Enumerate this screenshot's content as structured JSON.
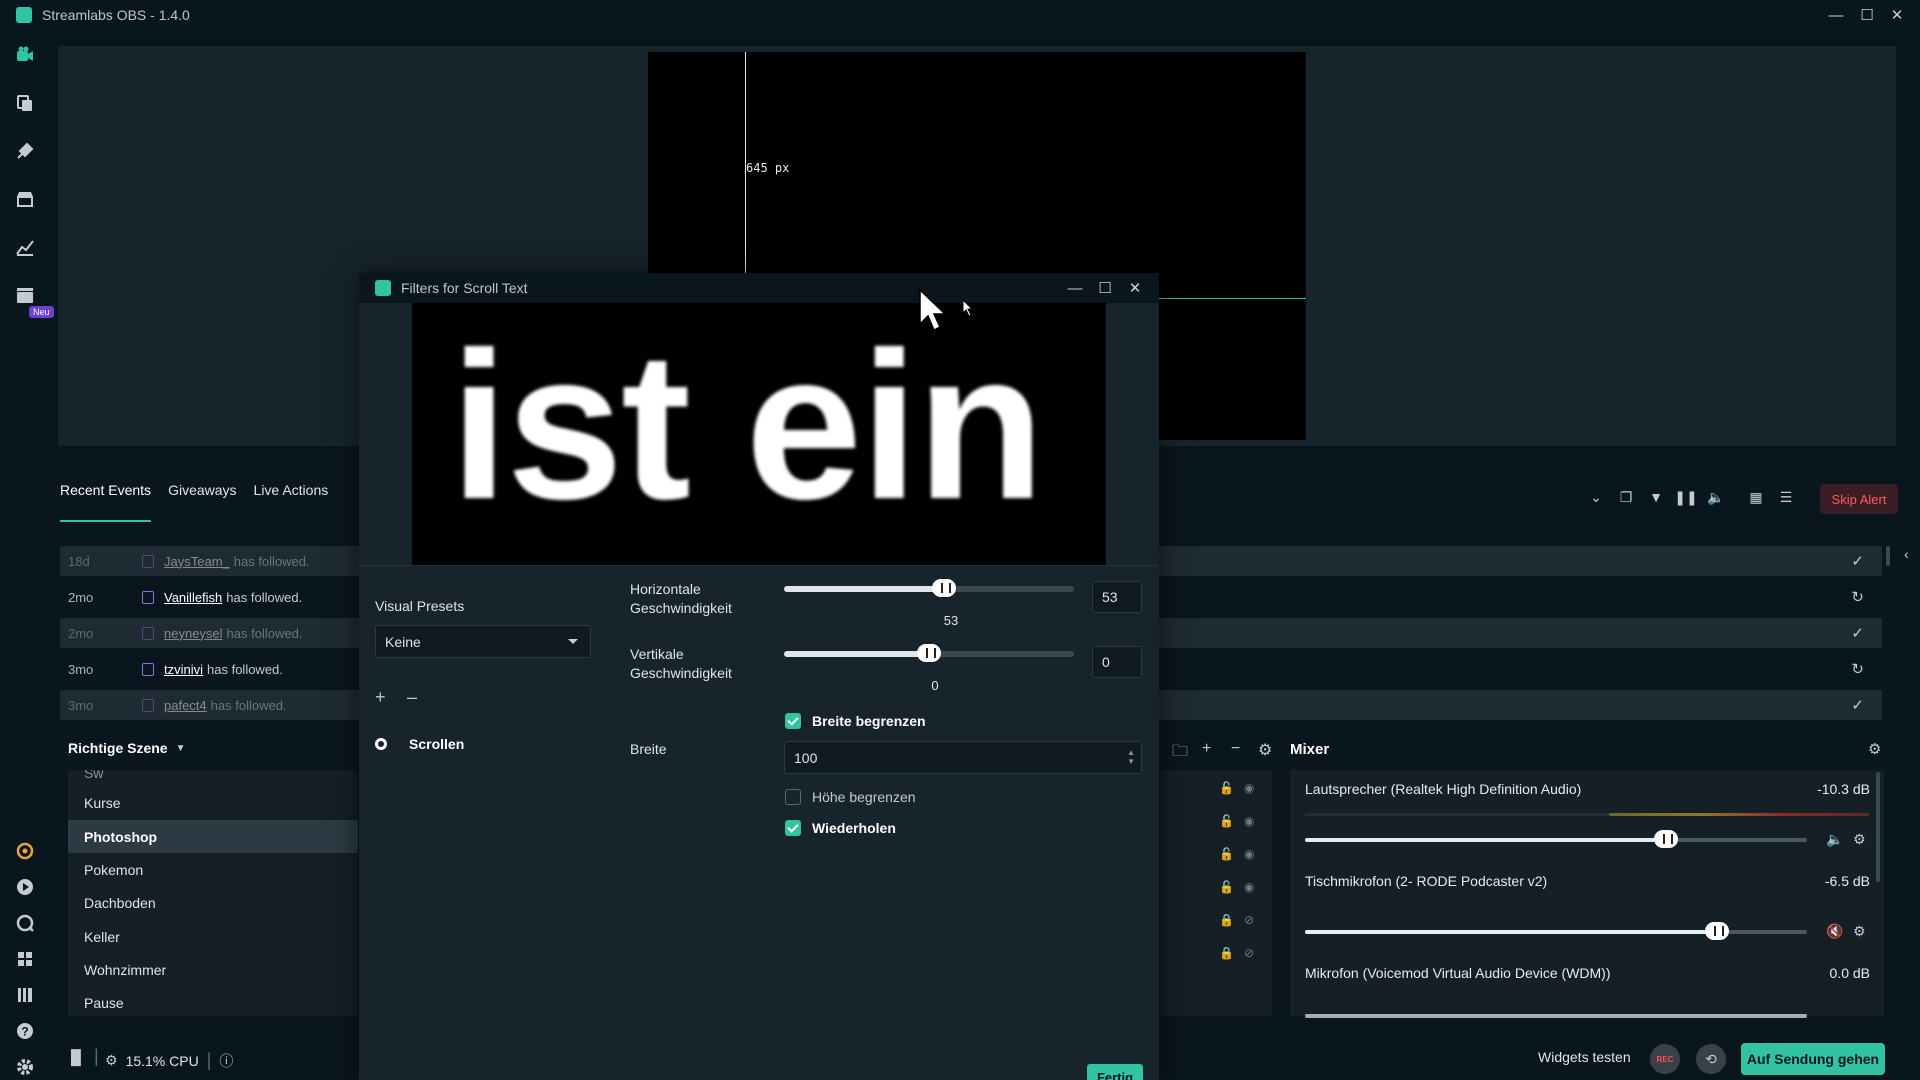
{
  "app": {
    "title": "Streamlabs OBS - 1.4.0"
  },
  "nav": {
    "icons": [
      "editor-icon",
      "library-icon",
      "themes-icon",
      "store-icon",
      "dashboard-icon",
      "studio-icon"
    ],
    "new_badge": "Neu",
    "bottom_icons": [
      "prime-icon",
      "play-icon",
      "chat-icon",
      "apps-icon",
      "columns-icon",
      "help-icon",
      "settings-icon"
    ]
  },
  "preview": {
    "guide_label": "645 px"
  },
  "events": {
    "tabs": [
      "Recent Events",
      "Giveaways",
      "Live Actions"
    ],
    "skip_alert": "Skip Alert",
    "rows": [
      {
        "time": "18d",
        "user": "JaysTeam_",
        "text": "has followed.",
        "dim": true,
        "action": "✓"
      },
      {
        "time": "2mo",
        "user": "Vanillefish",
        "text": "has followed.",
        "dim": false,
        "action": "↻"
      },
      {
        "time": "2mo",
        "user": "neyneysel",
        "text": "has followed.",
        "dim": true,
        "action": "✓"
      },
      {
        "time": "3mo",
        "user": "tzvinivi",
        "text": "has followed.",
        "dim": false,
        "action": "↻"
      },
      {
        "time": "3mo",
        "user": "pafect4",
        "text": "has followed.",
        "dim": true,
        "action": "✓"
      }
    ]
  },
  "scenes": {
    "header": "Richtige Szene",
    "partial_item": "Sw",
    "items": [
      "Kurse",
      "Photoshop",
      "Pokemon",
      "Dachboden",
      "Keller",
      "Wohnzimmer",
      "Pause"
    ],
    "active": "Photoshop"
  },
  "mixer": {
    "title": "Mixer",
    "channels": [
      {
        "name": "Lautsprecher (Realtek High Definition Audio)",
        "db": "-10.3 dB",
        "level": 0.72
      },
      {
        "name": "Tischmikrofon (2- RODE Podcaster v2)",
        "db": "-6.5 dB",
        "level": 0.82
      },
      {
        "name": "Mikrofon (Voicemod Virtual Audio Device (WDM))",
        "db": "0.0 dB",
        "level": 1.0
      }
    ]
  },
  "status": {
    "cpu": "15.1% CPU",
    "widgets_test": "Widgets testen",
    "rec": "REC",
    "go_live": "Auf Sendung gehen"
  },
  "dialog": {
    "title": "Filters for Scroll Text",
    "preview_text": "ist ein",
    "visual_presets_label": "Visual Presets",
    "visual_presets_value": "Keine",
    "add": "+",
    "remove": "–",
    "filters": [
      {
        "name": "Scrollen",
        "visible": true
      }
    ],
    "props": {
      "h_speed_label_1": "Horizontale",
      "h_speed_label_2": "Geschwindigkeit",
      "h_speed_value": "53",
      "h_speed_fraction": 0.55,
      "v_speed_label_1": "Vertikale",
      "v_speed_label_2": "Geschwindigkeit",
      "v_speed_value": "0",
      "v_speed_fraction": 0.5,
      "limit_width_label": "Breite begrenzen",
      "limit_width_checked": true,
      "width_label": "Breite",
      "width_value": "100",
      "limit_height_label": "Höhe begrenzen",
      "limit_height_checked": false,
      "loop_label": "Wiederholen",
      "loop_checked": true
    },
    "done": "Fertig"
  }
}
